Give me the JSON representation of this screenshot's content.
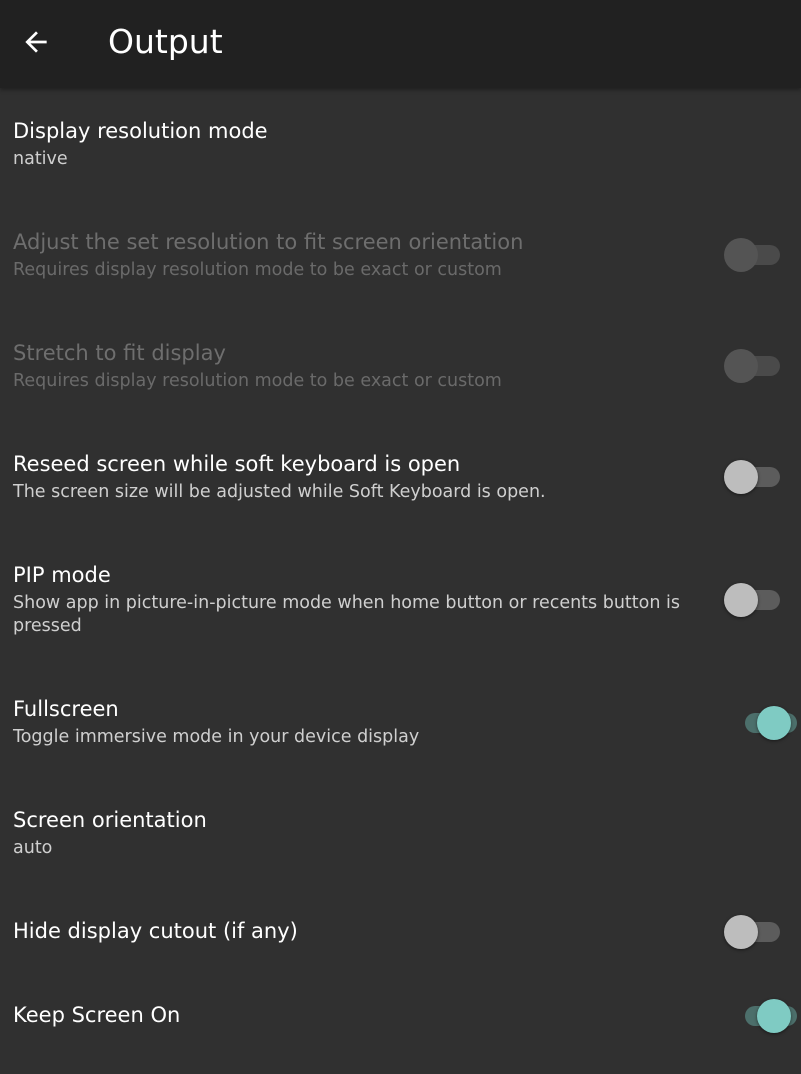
{
  "appbar": {
    "title": "Output",
    "back_icon": "arrow-left-icon"
  },
  "settings": [
    {
      "title": "Display resolution mode",
      "summary": "native",
      "type": "list",
      "enabled": true
    },
    {
      "title": "Adjust the set resolution to fit screen orientation",
      "summary": "Requires display resolution mode to be exact or custom",
      "type": "switch",
      "checked": false,
      "enabled": false
    },
    {
      "title": "Stretch to fit display",
      "summary": "Requires display resolution mode to be exact or custom",
      "type": "switch",
      "checked": false,
      "enabled": false
    },
    {
      "title": "Reseed screen while soft keyboard is open",
      "summary": "The screen size will be adjusted while Soft Keyboard is open.",
      "type": "switch",
      "checked": false,
      "enabled": true
    },
    {
      "title": "PIP mode",
      "summary": "Show app in picture-in-picture mode when home button or recents button is pressed",
      "type": "switch",
      "checked": false,
      "enabled": true
    },
    {
      "title": "Fullscreen",
      "summary": "Toggle immersive mode in your device display",
      "type": "switch",
      "checked": true,
      "enabled": true
    },
    {
      "title": "Screen orientation",
      "summary": "auto",
      "type": "list",
      "enabled": true
    },
    {
      "title": "Hide display cutout (if any)",
      "summary": "",
      "type": "switch",
      "checked": false,
      "enabled": true
    },
    {
      "title": "Keep Screen On",
      "summary": "",
      "type": "switch",
      "checked": true,
      "enabled": true
    }
  ],
  "colors": {
    "background": "#303030",
    "appbar": "#212121",
    "accent": "#7fcbc3"
  }
}
